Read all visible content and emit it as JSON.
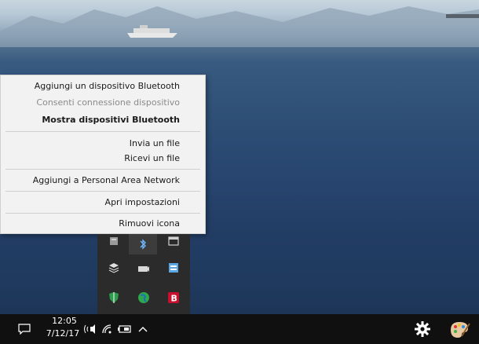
{
  "context_menu": {
    "items": [
      {
        "label": "Aggiungi un dispositivo Bluetooth"
      },
      {
        "label": "Consenti connessione dispositivo"
      },
      {
        "label": "Mostra dispositivi Bluetooth"
      },
      {
        "label": "Invia un file"
      },
      {
        "label": "Ricevi un file"
      },
      {
        "label": "Aggiungi a Personal Area Network"
      },
      {
        "label": "Apri impostazioni"
      },
      {
        "label": "Rimuovi icona"
      }
    ]
  },
  "tray_flyout": {
    "icons": [
      "generic-app-icon",
      "bluetooth-icon",
      "window-icon",
      "layers-icon",
      "camera-icon",
      "network-drive-icon",
      "shield-icon",
      "globe-icon",
      "red-b-icon"
    ]
  },
  "taskbar": {
    "clock_time": "12:05",
    "clock_date": "7/12/17",
    "icons": [
      "action-center-icon",
      "volume-icon",
      "wifi-icon",
      "battery-icon",
      "chevron-up-icon",
      "settings-gear-icon",
      "paint-palette-icon"
    ]
  },
  "colors": {
    "menu_bg": "#f2f2f2",
    "taskbar_bg": "#101010",
    "flyout_bg": "#2b2b2b",
    "red_icon": "#c8102e"
  }
}
